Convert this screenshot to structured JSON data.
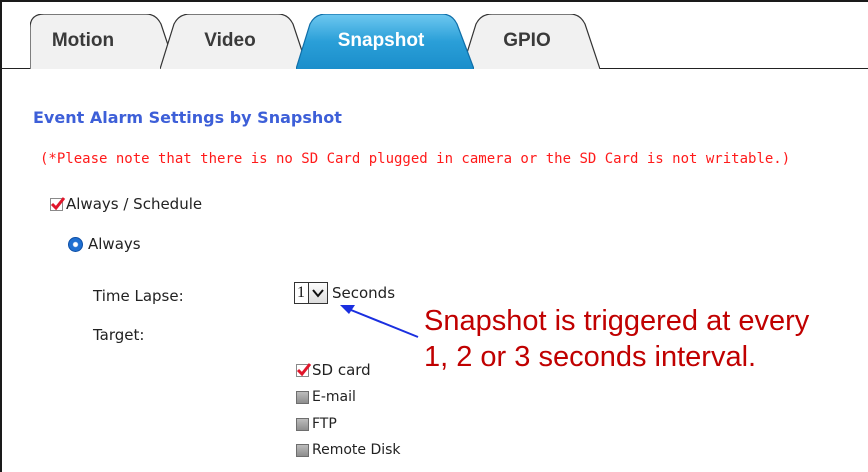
{
  "tabs": [
    {
      "label": "Motion",
      "active": false
    },
    {
      "label": "Video",
      "active": false
    },
    {
      "label": "Snapshot",
      "active": true
    },
    {
      "label": "GPIO",
      "active": false
    }
  ],
  "section_title": "Event Alarm Settings by Snapshot",
  "notice": "(*Please note that there is no SD Card plugged in camera or the SD Card is not writable.)",
  "always_schedule": {
    "label": "Always / Schedule",
    "checked": true
  },
  "always": {
    "label": "Always",
    "selected": true
  },
  "time_lapse": {
    "label": "Time Lapse:",
    "value": "1",
    "unit": "Seconds"
  },
  "target": {
    "label": "Target:",
    "options": [
      {
        "label": "SD card",
        "checked": true
      },
      {
        "label": "E-mail",
        "checked": false
      },
      {
        "label": "FTP",
        "checked": false
      },
      {
        "label": "Remote Disk",
        "checked": false
      }
    ]
  },
  "annotation": {
    "line1": "Snapshot is triggered at every",
    "line2": "1, 2 or 3 seconds interval."
  },
  "colors": {
    "active_tab": "#2a9fd8",
    "title_blue": "#3d5fd8",
    "notice_red": "#ff1a1a",
    "annotation_red": "#c00000",
    "arrow_blue": "#1a2fe0"
  }
}
